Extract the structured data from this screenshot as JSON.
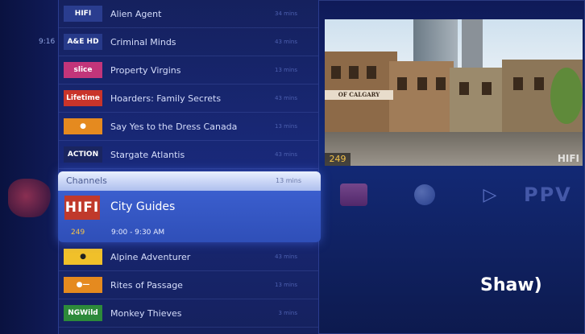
{
  "left_rail": {
    "time": "9:16"
  },
  "list_top": [
    {
      "logo": "HIFI",
      "title": "Alien Agent",
      "duration": "34 mins",
      "logo_color": "#2a3d8f"
    },
    {
      "logo": "A&E HD",
      "title": "Criminal Minds",
      "duration": "43 mins",
      "logo_color": "#273a8a"
    },
    {
      "logo": "slice",
      "title": "Property Virgins",
      "duration": "13 mins",
      "logo_color": "#c2357a"
    },
    {
      "logo": "Lifetime",
      "title": "Hoarders: Family Secrets",
      "duration": "43 mins",
      "logo_color": "#c9342a"
    },
    {
      "logo": "●",
      "title": "Say Yes to the Dress Canada",
      "duration": "13 mins",
      "logo_color": "#e58a1f"
    },
    {
      "logo": "ACTION",
      "title": "Stargate Atlantis",
      "duration": "43 mins",
      "logo_color": "#1a2560"
    }
  ],
  "highlight": {
    "section_label": "Channels",
    "duration": "13 mins",
    "logo": "HIFI",
    "title": "City Guides",
    "channel_number": "249",
    "time_range": "9:00 - 9:30 AM"
  },
  "list_bottom": [
    {
      "logo": "●",
      "title": "Alpine Adventurer",
      "duration": "43 mins",
      "logo_color": "#f0c02a"
    },
    {
      "logo": "●—",
      "title": "Rites of Passage",
      "duration": "13 mins",
      "logo_color": "#e58a1f"
    },
    {
      "logo": "NGWild",
      "title": "Monkey Thieves",
      "duration": "3 mins",
      "logo_color": "#2d8a3a"
    }
  ],
  "preview": {
    "channel_badge": "249",
    "sign_text": "OF CALGARY",
    "watermark": "HIFI"
  },
  "icons": [
    {
      "name": "media-icon"
    },
    {
      "name": "globe-icon"
    },
    {
      "name": "play-icon",
      "glyph": "▷"
    },
    {
      "name": "ppv-icon",
      "label": "PPV"
    }
  ],
  "brand": {
    "name": "Shaw)"
  }
}
